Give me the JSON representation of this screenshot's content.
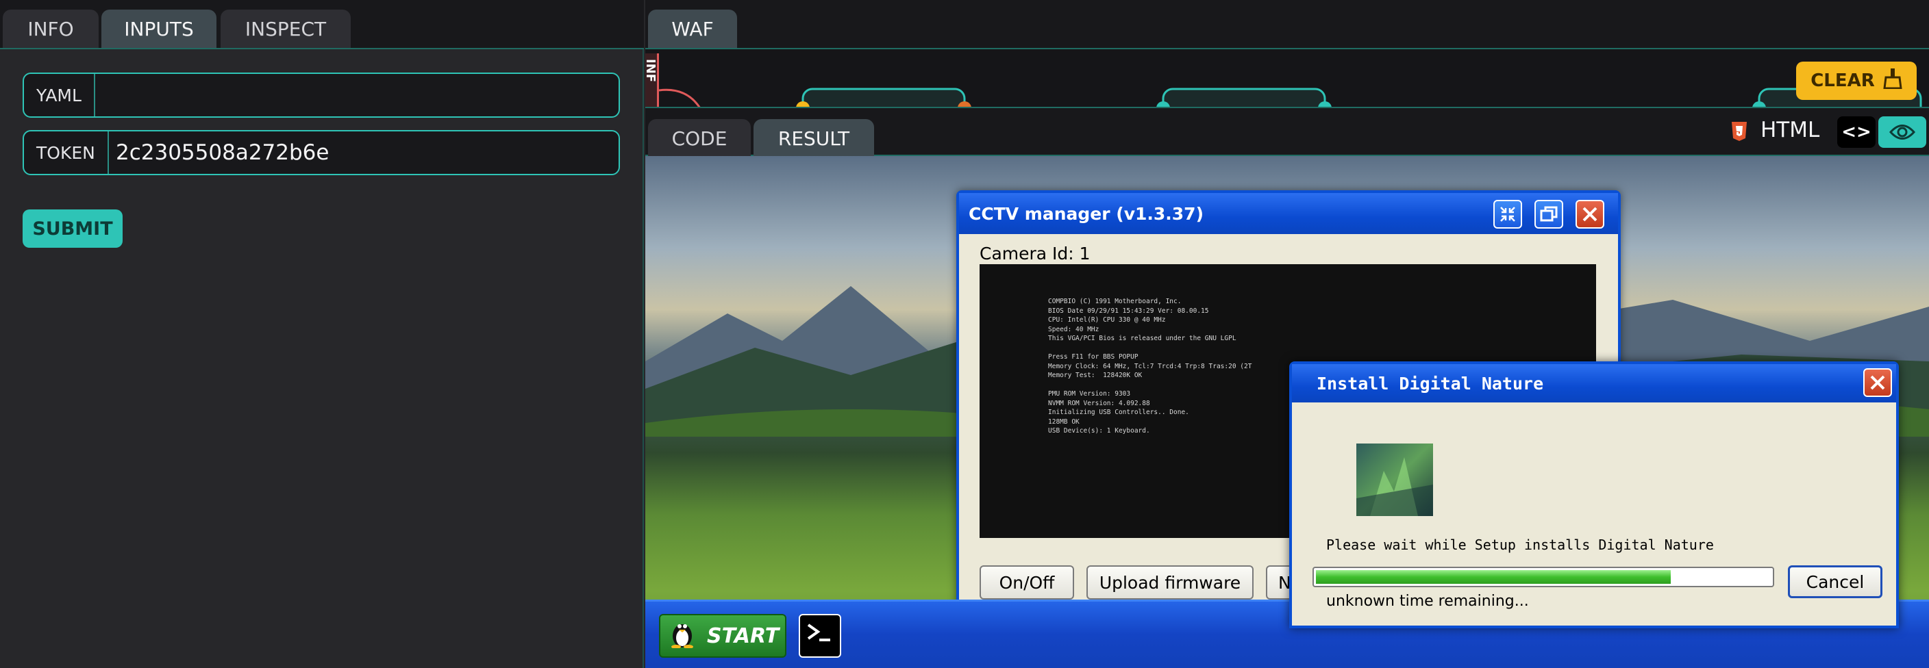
{
  "left": {
    "tabs": [
      "INFO",
      "INPUTS",
      "INSPECT"
    ],
    "fields": [
      {
        "label": "YAML",
        "value": ""
      },
      {
        "label": "TOKEN",
        "value": "2c2305508a272b6e"
      }
    ],
    "submit": "SUBMIT"
  },
  "right": {
    "top_tab": "WAF",
    "canvas_label": "INF",
    "clear": "CLEAR",
    "code_tabs": [
      "CODE",
      "RESULT"
    ],
    "lang": "HTML"
  },
  "cctv": {
    "title": "CCTV manager (v1.3.37)",
    "camera_label": "Camera Id: 1",
    "bios_lines": [
      "COMPBIO (C) 1991 Motherboard, Inc.",
      "BIOS Date 09/29/91 15:43:29 Ver: 08.00.15",
      "CPU: Intel(R) CPU 330 @ 40 MHz",
      "Speed: 40 MHz",
      "This VGA/PCI Bios is released under the GNU LGPL",
      "",
      "Press F11 for BBS POPUP",
      "Memory Clock: 64 MHz, Tcl:7 Trcd:4 Trp:8 Tras:20 (2T",
      "Memory Test:  128420K OK",
      "",
      "PMU ROM Version: 9303",
      "NVMM ROM Version: 4.092.88",
      "Initializing USB Controllers.. Done.",
      "128MB OK",
      "USB Device(s): 1 Keyboard."
    ],
    "buttons": [
      "On/Off",
      "Upload firmware",
      "N"
    ]
  },
  "install": {
    "title": "Install Digital Nature",
    "message": "Please wait while Setup installs Digital Nature",
    "progress": 0.78,
    "remaining": "unknown time remaining...",
    "cancel": "Cancel"
  },
  "taskbar": {
    "start": "START"
  },
  "colors": {
    "accent": "#2ec4b6",
    "clear": "#f5b81c",
    "xp_blue": "#0b4bd1"
  }
}
